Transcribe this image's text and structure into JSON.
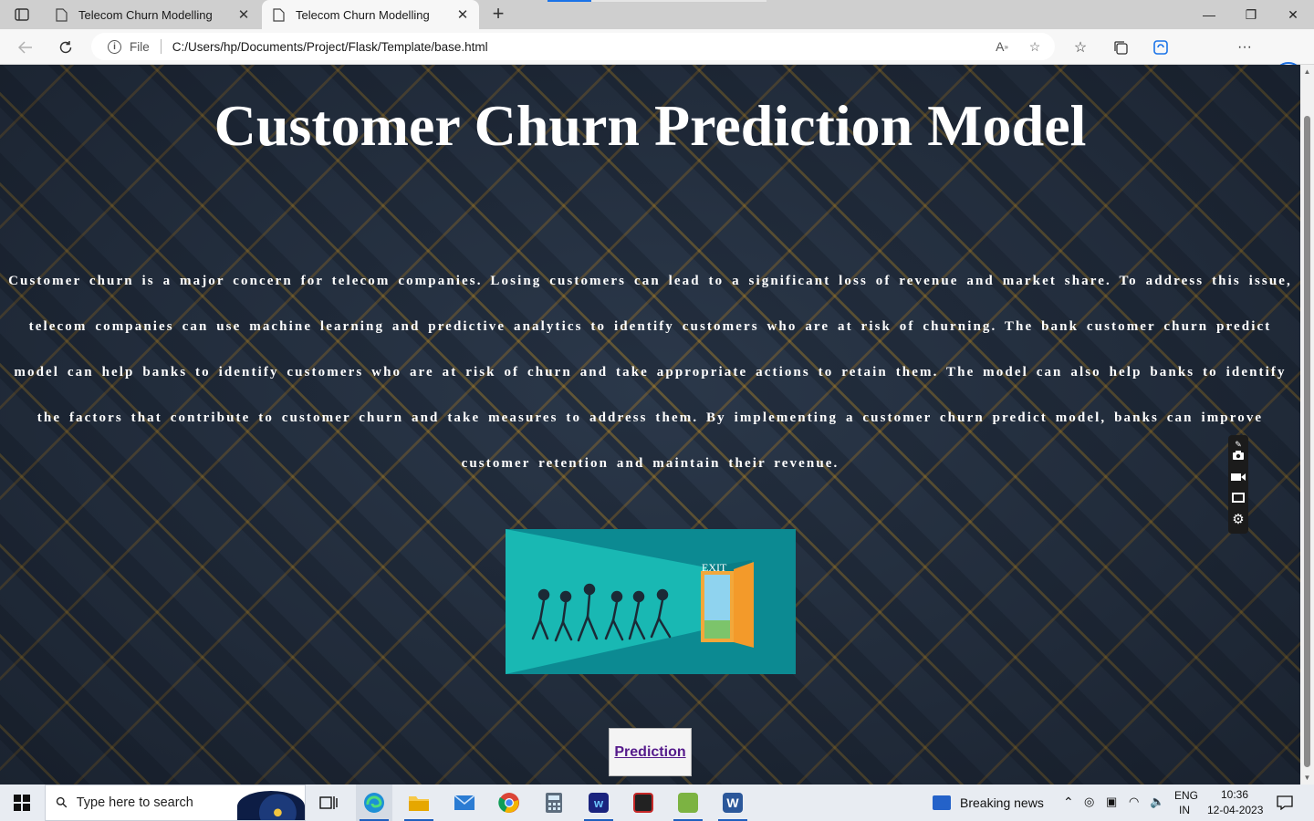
{
  "browser": {
    "tabs": [
      {
        "title": "Telecom Churn Modelling",
        "active": false
      },
      {
        "title": "Telecom Churn Modelling",
        "active": true
      }
    ],
    "new_tab_symbol": "+",
    "window_controls": {
      "minimize": "—",
      "restore": "❐",
      "close": "✕"
    },
    "address": {
      "scheme_label": "File",
      "url": "C:/Users/hp/Documents/Project/Flask/Template/base.html"
    },
    "icons": [
      "tab-actions-icon",
      "back-icon",
      "refresh-icon",
      "info-icon",
      "read-aloud-icon",
      "add-favorite-icon",
      "favorites-icon",
      "collections-icon",
      "browser-essentials-icon",
      "profile-icon",
      "more-icon",
      "bing-icon"
    ]
  },
  "page": {
    "title": "Customer Churn Prediction Model",
    "description": "Customer churn is a major concern for telecom companies. Losing customers can lead to a significant loss of revenue and market share. To address this issue, telecom companies can use machine learning and predictive analytics to identify customers who are at risk of churning. The bank customer churn predict model can help banks to identify customers who are at risk of churn and take appropriate actions to retain them. The model can also help banks to identify the factors that contribute to customer churn and take measures to address them. By implementing a customer churn predict model, banks can improve customer retention and maintain their revenue.",
    "image": {
      "sign_text": "EXIT"
    },
    "prediction_link": "Prediction"
  },
  "taskbar": {
    "search_placeholder": "Type here to search",
    "news_label": "Breaking news",
    "language_line1": "ENG",
    "language_line2": "IN",
    "time": "10:36",
    "date": "12-04-2023",
    "apps": [
      "task-view",
      "edge",
      "file-explorer",
      "mail",
      "chrome",
      "calculator",
      "app-blue",
      "app-red",
      "app-green",
      "word"
    ]
  }
}
